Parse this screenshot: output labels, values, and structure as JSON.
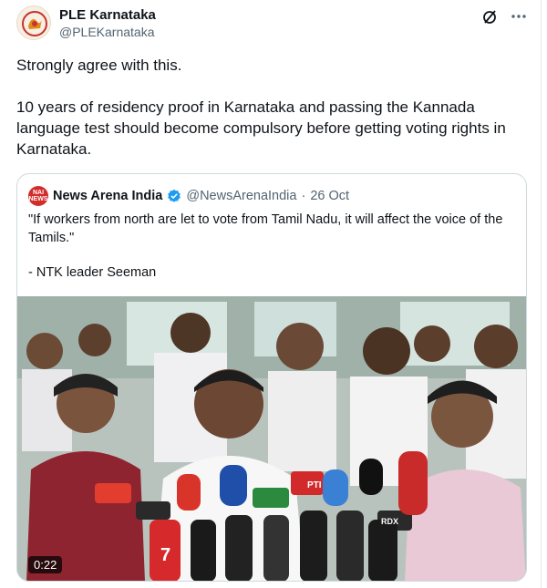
{
  "tweet": {
    "author_name": "PLE Karnataka",
    "author_handle": "@PLEKarnataka",
    "paragraphs": [
      "Strongly agree with this.",
      "10 years of residency proof in Karnataka and passing the Kannada language test should become compulsory before getting voting rights in Karnataka."
    ]
  },
  "quoted": {
    "avatar_text_top": "NAI",
    "avatar_text_bottom": "NEWS",
    "author_name": "News Arena India",
    "author_handle": "@NewsArenaIndia",
    "separator": "·",
    "date": "26 Oct",
    "quote_text": "\"If workers from north are let to vote from Tamil Nadu, it will affect the voice of the Tamils.\"",
    "attribution": "- NTK leader Seeman",
    "video_duration": "0:22",
    "mic_labels": [
      "PTI",
      "7",
      "RDX"
    ]
  },
  "icons": {
    "grok": "slash-circle-icon",
    "more": "more-dots-icon",
    "verified": "verified-badge-icon"
  },
  "colors": {
    "verified": "#1d9bf0",
    "brand_red": "#d42b2b",
    "text_secondary": "#536471",
    "border": "#cfd9de"
  }
}
